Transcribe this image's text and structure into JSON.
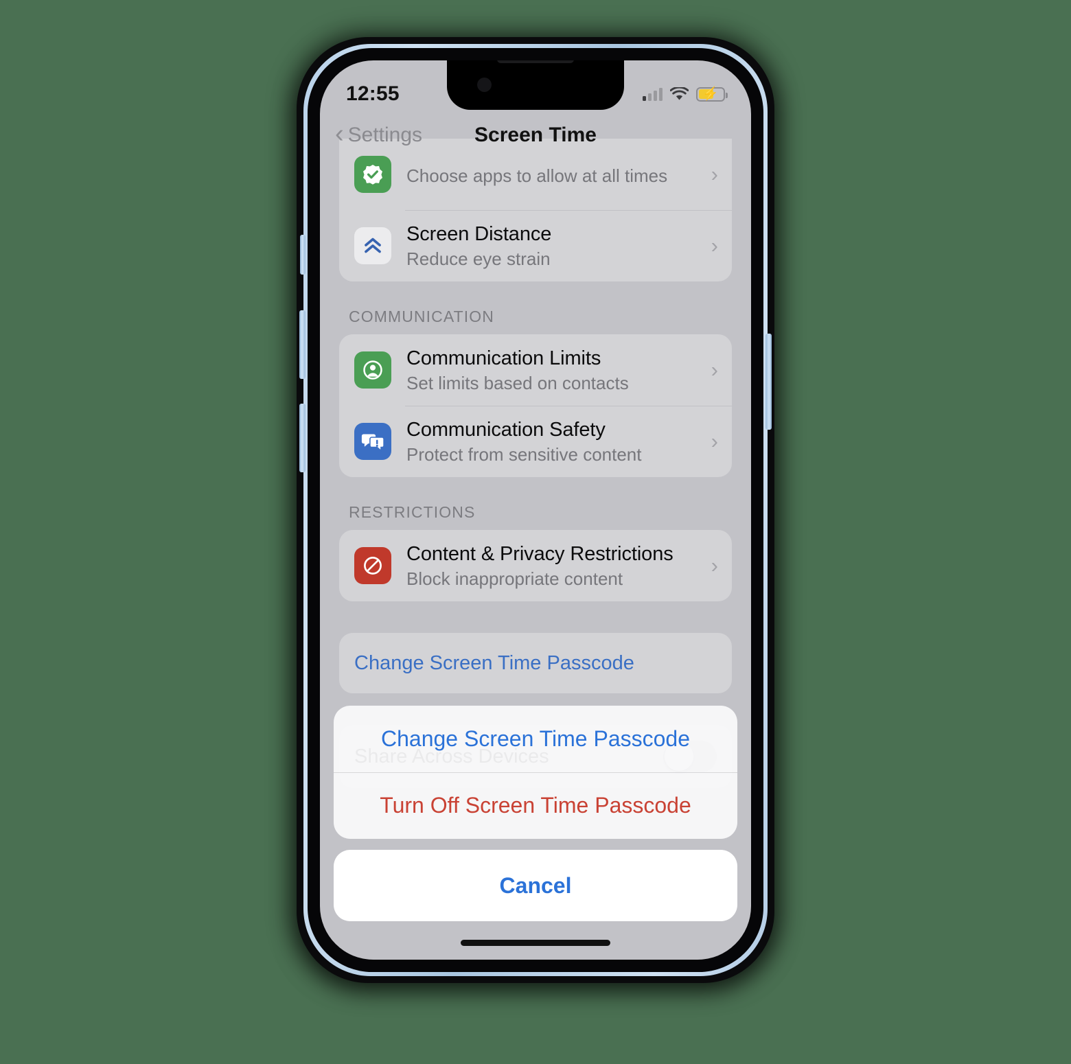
{
  "device": {
    "frame": "iphone",
    "body_color": "#b9d2ea",
    "screen_bg": "#c2c2c7",
    "page_bg": "#4a7052"
  },
  "status_bar": {
    "time": "12:55",
    "signal_icon": "cellular-signal-icon",
    "signal_bars_filled": 1,
    "signal_bars_total": 4,
    "wifi_icon": "wifi-icon",
    "battery_icon": "battery-charging-icon",
    "battery_charging": true,
    "battery_color": "#f3ca2f",
    "bolt_glyph": "⚡"
  },
  "nav_bar": {
    "back_icon": "chevron-left-icon",
    "back_label": "Settings",
    "title": "Screen Time"
  },
  "sections": [
    {
      "id": "top-partial",
      "header": "",
      "rows": [
        {
          "icon": "always-allowed-checkmark-icon",
          "icon_style": "green",
          "title": "",
          "subtitle": "Choose apps to allow at all times",
          "accessory": "chevron-right-icon",
          "accessory_glyph": "›"
        },
        {
          "icon": "screen-distance-chevrons-icon",
          "icon_style": "light",
          "title": "Screen Distance",
          "subtitle": "Reduce eye strain",
          "accessory": "chevron-right-icon",
          "accessory_glyph": "›"
        }
      ]
    },
    {
      "id": "communication",
      "header": "COMMUNICATION",
      "rows": [
        {
          "icon": "contact-person-icon",
          "icon_style": "green",
          "title": "Communication Limits",
          "subtitle": "Set limits based on contacts",
          "accessory": "chevron-right-icon",
          "accessory_glyph": "›"
        },
        {
          "icon": "message-bubbles-warning-icon",
          "icon_style": "blue",
          "title": "Communication Safety",
          "subtitle": "Protect from sensitive content",
          "accessory": "chevron-right-icon",
          "accessory_glyph": "›"
        }
      ]
    },
    {
      "id": "restrictions",
      "header": "RESTRICTIONS",
      "rows": [
        {
          "icon": "prohibited-sign-icon",
          "icon_style": "red",
          "title": "Content & Privacy Restrictions",
          "subtitle": "Block inappropriate content",
          "accessory": "chevron-right-icon",
          "accessory_glyph": "›"
        }
      ]
    }
  ],
  "passcode_row": {
    "label": "Change Screen Time Passcode",
    "color": "#3a6fc4"
  },
  "share_row": {
    "label": "Share Across Devices",
    "toggle_name": "share-across-devices-toggle",
    "toggle_on": false
  },
  "action_sheet": {
    "options": [
      {
        "label": "Change Screen Time Passcode",
        "style": "blue",
        "name": "change-screen-time-passcode-option"
      },
      {
        "label": "Turn Off Screen Time Passcode",
        "style": "red",
        "name": "turn-off-screen-time-passcode-option"
      }
    ],
    "cancel_label": "Cancel"
  }
}
